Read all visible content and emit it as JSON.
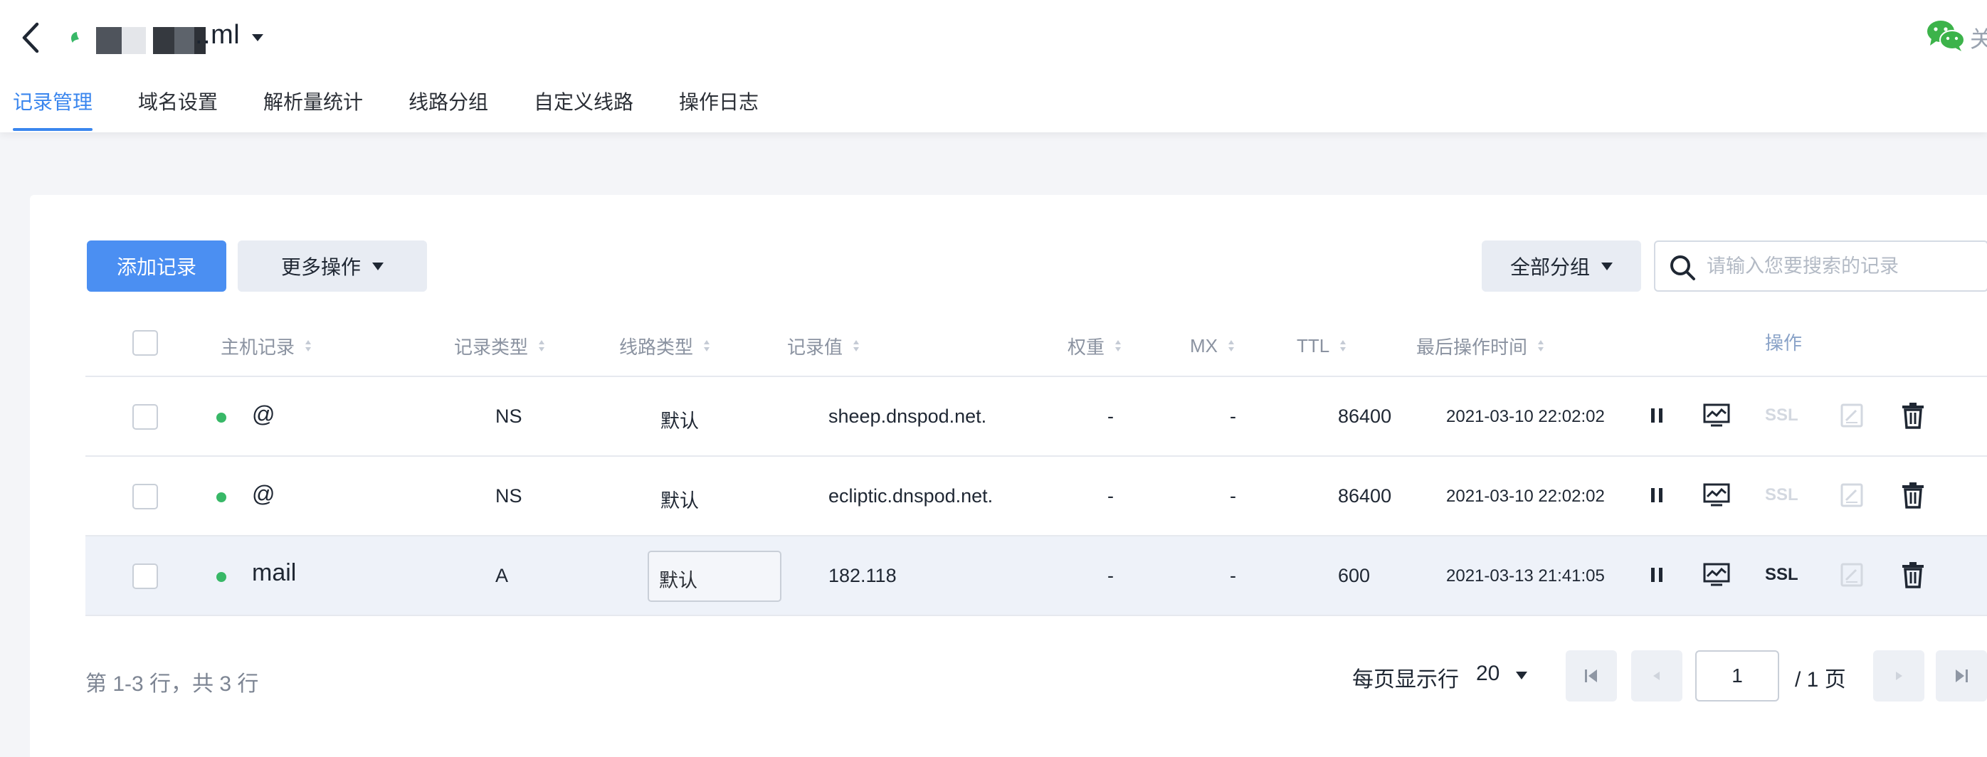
{
  "header": {
    "domain_suffix": "..ml",
    "wechat_text": "关"
  },
  "tabs": [
    {
      "label": "记录管理",
      "active": true
    },
    {
      "label": "域名设置"
    },
    {
      "label": "解析量统计"
    },
    {
      "label": "线路分组"
    },
    {
      "label": "自定义线路"
    },
    {
      "label": "操作日志"
    }
  ],
  "toolbar": {
    "add_record": "添加记录",
    "more_actions": "更多操作",
    "all_groups": "全部分组",
    "search_placeholder": "请输入您要搜索的记录"
  },
  "table": {
    "columns": {
      "host": "主机记录",
      "type": "记录类型",
      "line": "线路类型",
      "value": "记录值",
      "weight": "权重",
      "mx": "MX",
      "ttl": "TTL",
      "updated": "最后操作时间",
      "actions": "操作"
    },
    "ssl_label": "SSL",
    "rows": [
      {
        "host": "@",
        "type": "NS",
        "line": "默认",
        "value": "sheep.dnspod.net.",
        "weight": "-",
        "mx": "-",
        "ttl": "86400",
        "updated": "2021-03-10 22:02:02",
        "ssl_enabled": false
      },
      {
        "host": "@",
        "type": "NS",
        "line": "默认",
        "value": "ecliptic.dnspod.net.",
        "weight": "-",
        "mx": "-",
        "ttl": "86400",
        "updated": "2021-03-10 22:02:02",
        "ssl_enabled": false
      },
      {
        "host": "mail",
        "type": "A",
        "line": "默认",
        "value": "182.118",
        "weight": "-",
        "mx": "-",
        "ttl": "600",
        "updated": "2021-03-13 21:41:05",
        "ssl_enabled": true
      }
    ]
  },
  "pagination": {
    "summary": "第 1-3 行，共 3 行",
    "page_size_label": "每页显示行",
    "page_size": "20",
    "current_page": "1",
    "total_pages": "/ 1 页"
  },
  "colors": {
    "accent": "#3a86ee",
    "primary_button": "#4b8ff2",
    "status_enabled": "#38b867",
    "highlight_row": "#eef2f9",
    "wechat": "#3cb34a"
  },
  "icons": [
    "back-arrow-icon",
    "status-dot-icon",
    "caret-down-icon",
    "wechat-icon",
    "search-icon",
    "sort-icon",
    "pause-icon",
    "monitor-icon",
    "edit-note-icon",
    "trash-icon",
    "first-page-icon",
    "prev-page-icon",
    "next-page-icon",
    "last-page-icon"
  ]
}
